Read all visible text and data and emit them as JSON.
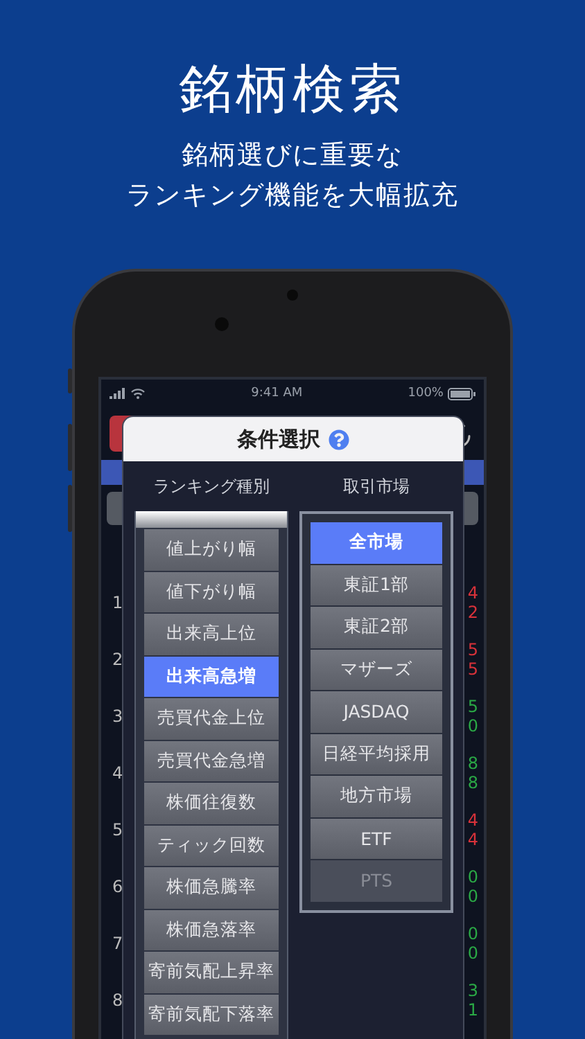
{
  "page": {
    "title": "銘柄検索",
    "subtitle_lines": [
      "銘柄選びに重要な",
      "ランキング機能を大幅拡充"
    ]
  },
  "status_bar": {
    "time": "9:41 AM",
    "battery": "100%"
  },
  "background_list": {
    "rows": [
      {
        "rank": "1",
        "values": [
          {
            "text": "4",
            "color": "#d8323a"
          },
          {
            "text": "2",
            "color": "#d8323a"
          }
        ]
      },
      {
        "rank": "2",
        "values": [
          {
            "text": "5",
            "color": "#d8323a"
          },
          {
            "text": "5",
            "color": "#d8323a"
          }
        ]
      },
      {
        "rank": "3",
        "values": [
          {
            "text": "5",
            "color": "#2aa845"
          },
          {
            "text": "0",
            "color": "#2aa845"
          }
        ]
      },
      {
        "rank": "4",
        "values": [
          {
            "text": "8",
            "color": "#2aa845"
          },
          {
            "text": "8",
            "color": "#2aa845"
          }
        ]
      },
      {
        "rank": "5",
        "values": [
          {
            "text": "4",
            "color": "#d8323a"
          },
          {
            "text": "4",
            "color": "#d8323a"
          }
        ]
      },
      {
        "rank": "6",
        "values": [
          {
            "text": "0",
            "color": "#2aa845"
          },
          {
            "text": "0",
            "color": "#2aa845"
          }
        ]
      },
      {
        "rank": "7",
        "values": [
          {
            "text": "0",
            "color": "#2aa845"
          },
          {
            "text": "0",
            "color": "#2aa845"
          }
        ]
      },
      {
        "rank": "8",
        "values": [
          {
            "text": "3",
            "color": "#2aa845"
          },
          {
            "text": "1",
            "color": "#2aa845"
          }
        ]
      }
    ]
  },
  "dialog": {
    "title": "条件選択",
    "columns": [
      {
        "heading": "ランキング種別",
        "kind": "picker",
        "items": [
          {
            "label": "値上がり幅",
            "selected": false,
            "disabled": false
          },
          {
            "label": "値下がり幅",
            "selected": false,
            "disabled": false
          },
          {
            "label": "出来高上位",
            "selected": false,
            "disabled": false
          },
          {
            "label": "出来高急増",
            "selected": true,
            "disabled": false
          },
          {
            "label": "売買代金上位",
            "selected": false,
            "disabled": false
          },
          {
            "label": "売買代金急増",
            "selected": false,
            "disabled": false
          },
          {
            "label": "株価往復数",
            "selected": false,
            "disabled": false
          },
          {
            "label": "ティック回数",
            "selected": false,
            "disabled": false
          },
          {
            "label": "株価急騰率",
            "selected": false,
            "disabled": false
          },
          {
            "label": "株価急落率",
            "selected": false,
            "disabled": false
          },
          {
            "label": "寄前気配上昇率",
            "selected": false,
            "disabled": false
          },
          {
            "label": "寄前気配下落率",
            "selected": false,
            "disabled": false
          }
        ]
      },
      {
        "heading": "取引市場",
        "kind": "list",
        "items": [
          {
            "label": "全市場",
            "selected": true,
            "disabled": false
          },
          {
            "label": "東証1部",
            "selected": false,
            "disabled": false
          },
          {
            "label": "東証2部",
            "selected": false,
            "disabled": false
          },
          {
            "label": "マザーズ",
            "selected": false,
            "disabled": false
          },
          {
            "label": "JASDAQ",
            "selected": false,
            "disabled": false
          },
          {
            "label": "日経平均採用",
            "selected": false,
            "disabled": false
          },
          {
            "label": "地方市場",
            "selected": false,
            "disabled": false
          },
          {
            "label": "ETF",
            "selected": false,
            "disabled": false
          },
          {
            "label": "PTS",
            "selected": false,
            "disabled": true
          }
        ]
      }
    ]
  }
}
